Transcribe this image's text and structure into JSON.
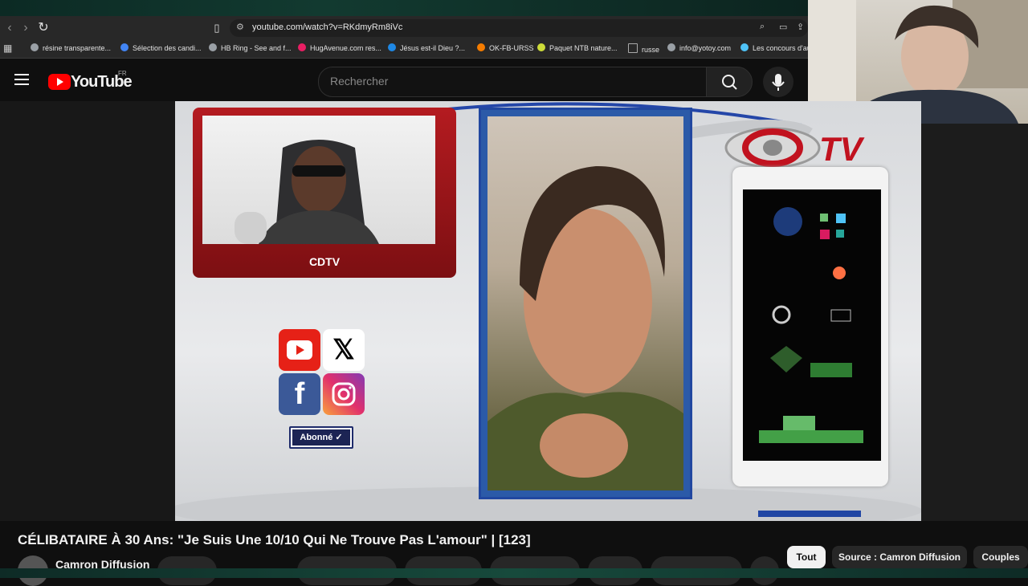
{
  "browser": {
    "url": "youtube.com/watch?v=RKdmyRm8iVc",
    "bookmarks": [
      {
        "label": "résine transparente...",
        "color": "#9aa0a6"
      },
      {
        "label": "Sélection des candi...",
        "color": "#4285f4"
      },
      {
        "label": "HB Ring - See and f...",
        "color": "#9aa0a6"
      },
      {
        "label": "HugAvenue.com res...",
        "color": "#e91e63"
      },
      {
        "label": "Jésus est-il Dieu ?...",
        "color": "#1e88e5"
      },
      {
        "label": "OK-FB-URSS",
        "color": "#f57c00"
      },
      {
        "label": "Paquet NTB nature...",
        "color": "#cddc39"
      },
      {
        "label": "russe",
        "color": "#9aa0a6"
      },
      {
        "label": "info@yotoy.com",
        "color": "#9aa0a6"
      },
      {
        "label": "Les concours d'au",
        "color": "#4fc3f7"
      }
    ]
  },
  "youtube": {
    "logo_text": "YouTube",
    "region": "FR",
    "search_placeholder": "Rechercher"
  },
  "video_overlay": {
    "host_banner": "CDTV",
    "logo_text": "TV",
    "subscribe_label": "Abonné ✓"
  },
  "below_video": {
    "title": "CÉLIBATAIRE À 30 Ans: \"Je Suis Une 10/10 Qui Ne Trouve Pas L'amour\" | [123]",
    "channel_name": "Camron Diffusion",
    "chips": [
      "Tout",
      "Source : Camron Diffusion",
      "Couples"
    ]
  },
  "colors": {
    "youtube_red": "#ff0000",
    "cdtv_red": "#c1121f",
    "guest_frame_blue": "#2b5aa8"
  }
}
